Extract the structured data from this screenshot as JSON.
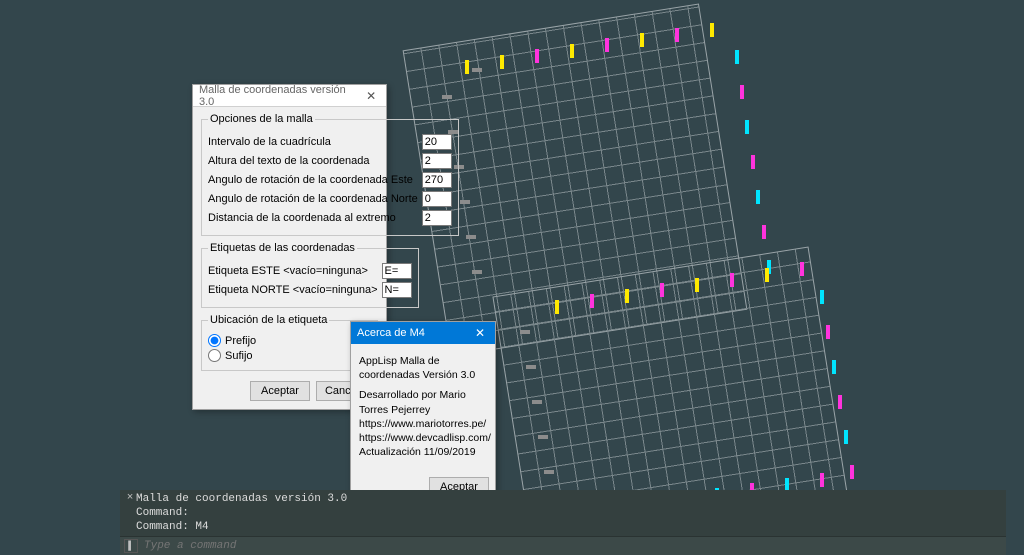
{
  "dialog1": {
    "title": "Malla de coordenadas versión 3.0",
    "group_grid_legend": "Opciones de la malla",
    "fields": {
      "interval_label": "Intervalo de la cuadrícula",
      "interval_value": "20",
      "textheight_label": "Altura del texto de la coordenada",
      "textheight_value": "2",
      "rot_east_label": "Angulo de rotación de la coordenada Este",
      "rot_east_value": "270",
      "rot_north_label": "Angulo de rotación de la coordenada Norte",
      "rot_north_value": "0",
      "extreme_dist_label": "Distancia de la coordenada al extremo",
      "extreme_dist_value": "2"
    },
    "group_labels_legend": "Etiquetas de las coordenadas",
    "labels": {
      "east_label": "Etiqueta ESTE <vacío=ninguna>",
      "east_value": "E=",
      "north_label": "Etiqueta NORTE <vacío=ninguna>",
      "north_value": "N="
    },
    "group_pos_legend": "Ubicación de la etiqueta",
    "radio_prefix": "Prefijo",
    "radio_suffix": "Sufijo",
    "accept": "Aceptar",
    "cancel": "Cancelar"
  },
  "dialog2": {
    "title": "Acerca de M4",
    "line1": "AppLisp Malla de coordenadas Versión 3.0",
    "line2": "Desarrollado por Mario Torres Pejerrey",
    "line3": "https://www.mariotorres.pe/",
    "line4": "https://www.devcadlisp.com/",
    "line5": "Actualización 11/09/2019",
    "accept": "Aceptar"
  },
  "command": {
    "hist1": "Malla de coordenadas versión 3.0",
    "hist2": "Command:",
    "hist3": "Command: M4",
    "placeholder": "Type a command"
  }
}
